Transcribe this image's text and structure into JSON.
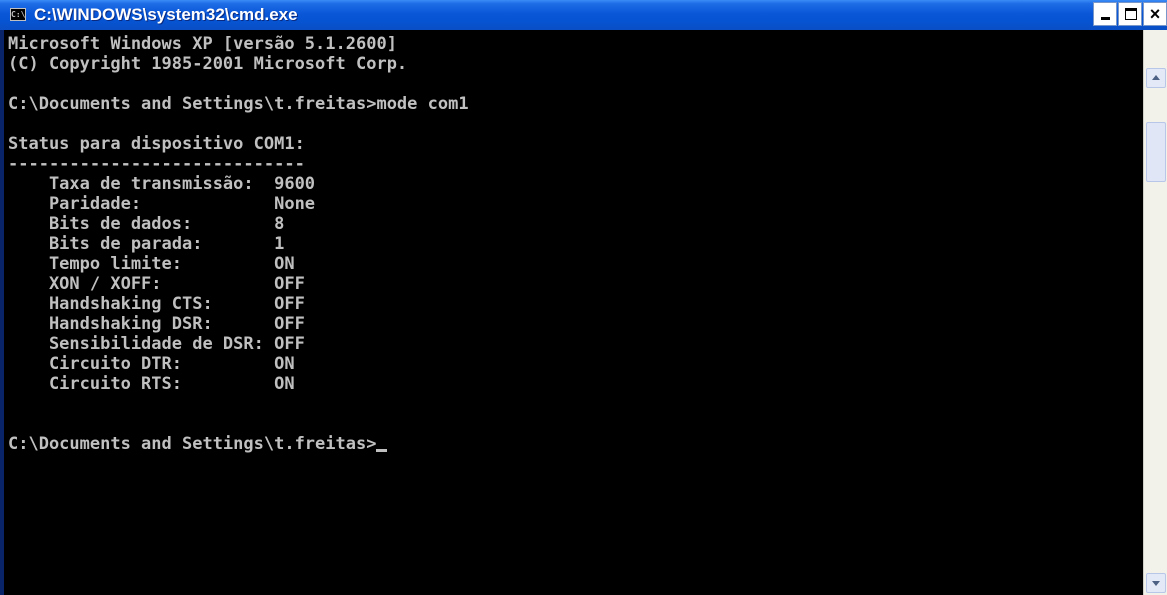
{
  "window": {
    "title": "C:\\WINDOWS\\system32\\cmd.exe",
    "icon": "cmd-icon",
    "icon_text": "C:\\"
  },
  "titlebar_buttons": {
    "minimize_icon": "minimize-icon",
    "maximize_icon": "maximize-icon",
    "close_icon": "close-icon",
    "close_glyph": "×"
  },
  "console": {
    "lines": [
      "Microsoft Windows XP [versão 5.1.2600]",
      "(C) Copyright 1985-2001 Microsoft Corp.",
      "",
      "C:\\Documents and Settings\\t.freitas>mode com1",
      "",
      "Status para dispositivo COM1:",
      "-----------------------------",
      "    Taxa de transmissão:  9600",
      "    Paridade:             None",
      "    Bits de dados:        8",
      "    Bits de parada:       1",
      "    Tempo limite:         ON",
      "    XON / XOFF:           OFF",
      "    Handshaking CTS:      OFF",
      "    Handshaking DSR:      OFF",
      "    Sensibilidade de DSR: OFF",
      "    Circuito DTR:         ON",
      "    Circuito RTS:         ON",
      "",
      "",
      "C:\\Documents and Settings\\t.freitas>"
    ]
  },
  "colors": {
    "console_bg": "#000000",
    "console_fg": "#c0c0c0",
    "titlebar": "#0a58d8"
  }
}
